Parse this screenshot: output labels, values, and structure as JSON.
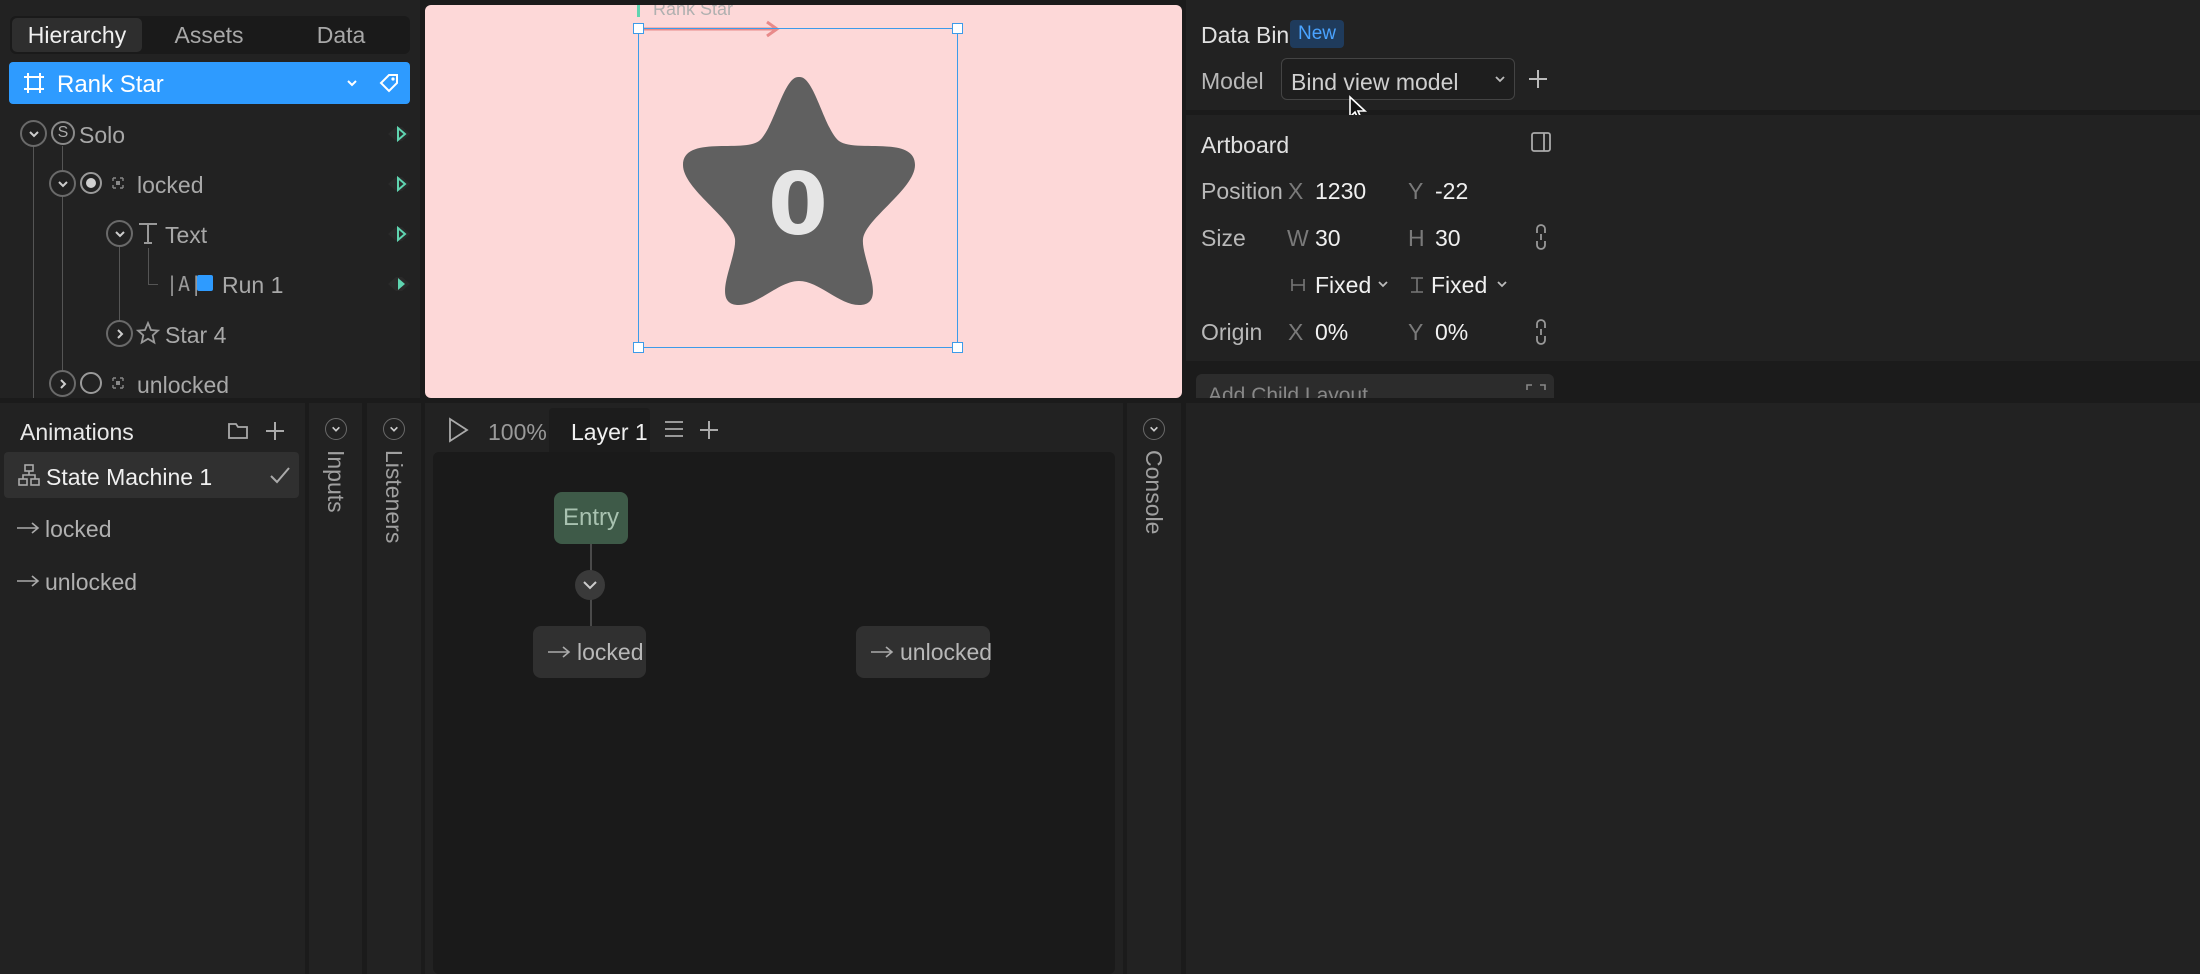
{
  "hierarchy": {
    "tabs": [
      "Hierarchy",
      "Assets",
      "Data"
    ],
    "selected": "Rank Star",
    "tree": {
      "solo": "Solo",
      "locked": "locked",
      "text": "Text",
      "run": "Run 1",
      "star": "Star 4",
      "unlocked": "unlocked"
    }
  },
  "canvas": {
    "artboard_label": "Rank Star",
    "star_text": "0"
  },
  "inspector": {
    "data_bind_title": "Data Bind",
    "new_badge": "New",
    "model_label": "Model",
    "model_value": "Bind view model",
    "artboard_title": "Artboard",
    "position_label": "Position",
    "x_axis": "X",
    "x_value": "1230",
    "y_axis": "Y",
    "y_value": "-22",
    "size_label": "Size",
    "w_axis": "W",
    "w_value": "30",
    "h_axis": "H",
    "h_value": "30",
    "width_mode": "Fixed",
    "height_mode": "Fixed",
    "origin_label": "Origin",
    "origin_x_axis": "X",
    "origin_x": "0%",
    "origin_y_axis": "Y",
    "origin_y": "0%",
    "add_child_layout": "Add Child Layout"
  },
  "animations": {
    "title": "Animations",
    "state_machine": "State Machine 1",
    "items": [
      "locked",
      "unlocked"
    ]
  },
  "side_tabs": {
    "inputs": "Inputs",
    "listeners": "Listeners",
    "console": "Console"
  },
  "graph": {
    "zoom": "100%",
    "layer_tab": "Layer 1",
    "entry": "Entry",
    "node_locked": "locked",
    "node_unlocked": "unlocked"
  },
  "colors": {
    "accent": "#2e9bff",
    "canvas_bg": "#fdd8d8",
    "star_fill": "#606060",
    "entry_node": "#3e5a48",
    "teal": "#5fd4b0",
    "badge_bg": "#1f3b5c",
    "badge_text": "#4aa3ff"
  }
}
